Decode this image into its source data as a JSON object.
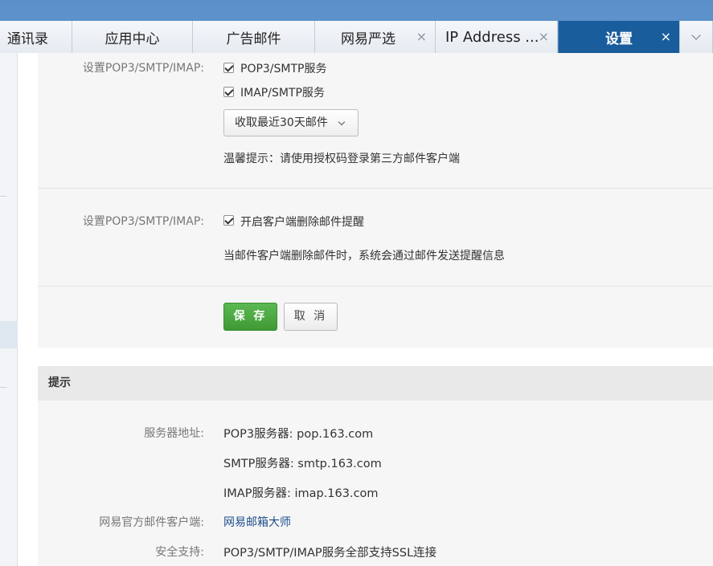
{
  "tabs": [
    {
      "label": "通讯录",
      "closable": false
    },
    {
      "label": "应用中心",
      "closable": false
    },
    {
      "label": "广告邮件",
      "closable": false
    },
    {
      "label": "网易严选",
      "closable": true
    },
    {
      "label": "IP Address ...",
      "closable": true
    },
    {
      "label": "设置",
      "closable": true,
      "active": true
    }
  ],
  "tab_close_glyph": "×",
  "section1": {
    "label": "设置POP3/SMTP/IMAP:",
    "option_pop3": {
      "label": "POP3/SMTP服务",
      "checked": true
    },
    "option_imap": {
      "label": "IMAP/SMTP服务",
      "checked": true
    },
    "fetch_select": {
      "value": "收取最近30天邮件"
    },
    "tip": "温馨提示：请使用授权码登录第三方邮件客户端"
  },
  "section2": {
    "label": "设置POP3/SMTP/IMAP:",
    "option_delete_alert": {
      "label": "开启客户端删除邮件提醒",
      "checked": true
    },
    "description": "当邮件客户端删除邮件时，系统会通过邮件发送提醒信息"
  },
  "buttons": {
    "save": "保 存",
    "cancel": "取 消"
  },
  "hints": {
    "title": "提示",
    "server_label": "服务器地址:",
    "pop3": "POP3服务器: pop.163.com",
    "smtp": "SMTP服务器: smtp.163.com",
    "imap": "IMAP服务器: imap.163.com",
    "client_label": "网易官方邮件客户端:",
    "client_link": "网易邮箱大师",
    "security_label": "安全支持:",
    "security_text": "POP3/SMTP/IMAP服务全部支持SSL连接"
  },
  "colors": {
    "accent": "#1a5d9c",
    "save_green": "#4caf3f",
    "link": "#1e4e8c"
  }
}
